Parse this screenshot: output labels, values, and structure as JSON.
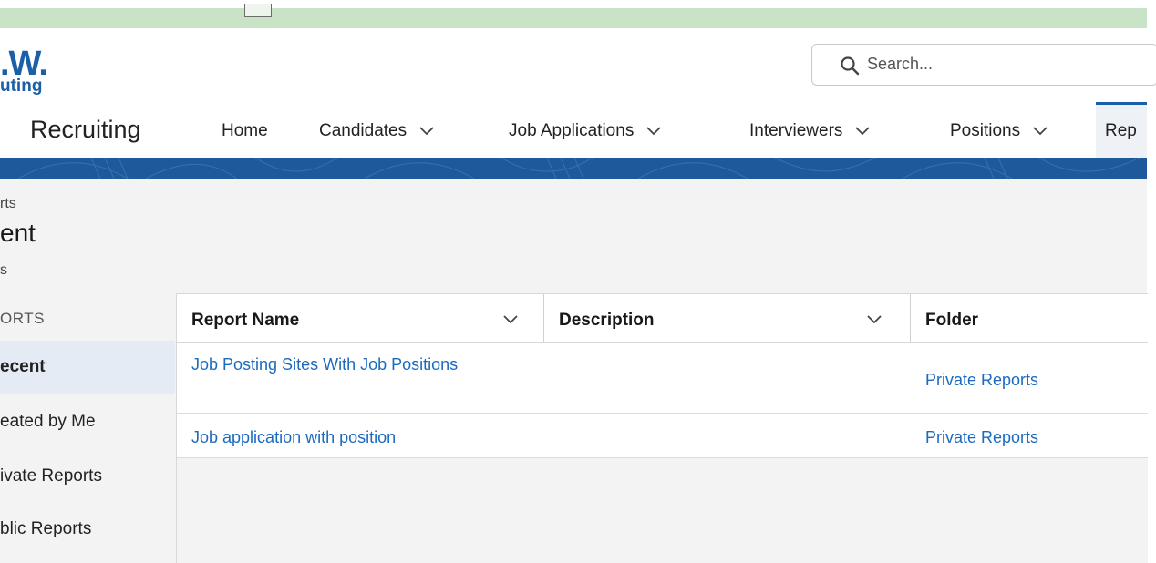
{
  "header": {
    "logo_main": ".W.",
    "logo_sub": "uting",
    "search_placeholder": "Search..."
  },
  "nav": {
    "app_name": "Recruiting",
    "items": [
      {
        "label": "Home"
      },
      {
        "label": "Candidates"
      },
      {
        "label": "Job Applications"
      },
      {
        "label": "Interviewers"
      },
      {
        "label": "Positions"
      },
      {
        "label": "Rep"
      }
    ]
  },
  "page": {
    "breadcrumb": "rts",
    "title": "ent",
    "subtitle": "s"
  },
  "sidebar": {
    "heading": "ORTS",
    "items": [
      {
        "label": "ecent"
      },
      {
        "label": "eated by Me"
      },
      {
        "label": "ivate Reports"
      },
      {
        "label": "blic Reports"
      }
    ]
  },
  "table": {
    "columns": [
      {
        "label": "Report Name"
      },
      {
        "label": "Description"
      },
      {
        "label": "Folder"
      }
    ],
    "rows": [
      {
        "name": "Job Posting Sites With Job Positions",
        "description": "",
        "folder": "Private Reports"
      },
      {
        "name": "Job application with position",
        "description": "",
        "folder": "Private Reports"
      }
    ]
  },
  "colors": {
    "brand_blue": "#1b5fa8",
    "link_blue": "#1b6ac0",
    "banner_blue": "#1e5a9b",
    "top_strip_green": "#c8e3c5"
  },
  "icons": [
    "search-icon",
    "chevron-down-icon"
  ]
}
